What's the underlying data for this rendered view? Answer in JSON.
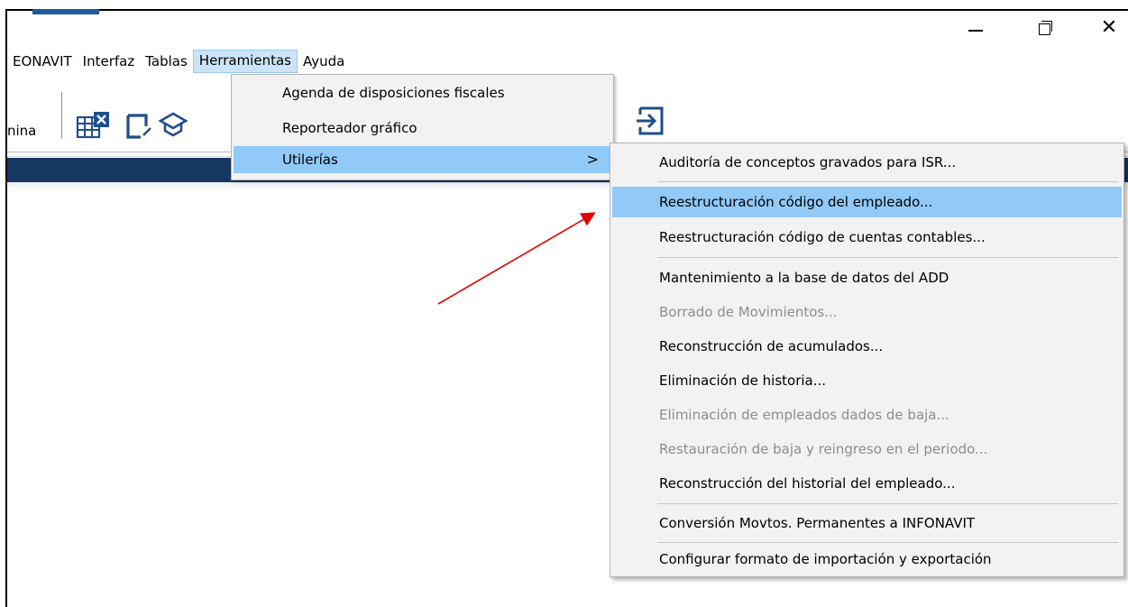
{
  "window": {
    "min_glyph": "—",
    "close_glyph": "✕"
  },
  "menubar": {
    "items": [
      {
        "label": "EONAVIT"
      },
      {
        "label": "Interfaz"
      },
      {
        "label": "Tablas"
      },
      {
        "label": "Herramientas"
      },
      {
        "label": "Ayuda"
      }
    ]
  },
  "toolbar": {
    "left_label": "nina"
  },
  "herramientas_menu": {
    "items": [
      {
        "label": "Agenda de disposiciones fiscales"
      },
      {
        "label": "Reporteador gráfico"
      },
      {
        "label": "Utilerías",
        "submenu_arrow": ">"
      }
    ]
  },
  "utilerias_submenu": {
    "items": [
      {
        "label": "Auditoría de conceptos gravados para ISR...",
        "enabled": true
      },
      {
        "label": "Reestructuración código del empleado...",
        "enabled": true,
        "highlighted": true
      },
      {
        "label": "Reestructuración código de cuentas contables...",
        "enabled": true
      },
      {
        "label": "Mantenimiento a la base de datos del ADD",
        "enabled": true
      },
      {
        "label": "Borrado de Movimientos...",
        "enabled": false
      },
      {
        "label": "Reconstrucción de acumulados...",
        "enabled": true
      },
      {
        "label": "Eliminación de historia...",
        "enabled": true
      },
      {
        "label": "Eliminación de empleados dados de baja...",
        "enabled": false
      },
      {
        "label": "Restauración de baja y reingreso en el periodo...",
        "enabled": false
      },
      {
        "label": "Reconstrucción del historial del empleado...",
        "enabled": true
      },
      {
        "label": "Conversión Movtos. Permanentes a INFONAVIT",
        "enabled": true
      },
      {
        "label": "Configurar formato de importación y exportación",
        "enabled": true
      }
    ]
  },
  "colors": {
    "highlight": "#91c9f7",
    "menu_bg": "#f2f2f2",
    "disabled_text": "#8c8c8c",
    "header_bar": "#173763",
    "annotation_arrow": "#e00000"
  }
}
